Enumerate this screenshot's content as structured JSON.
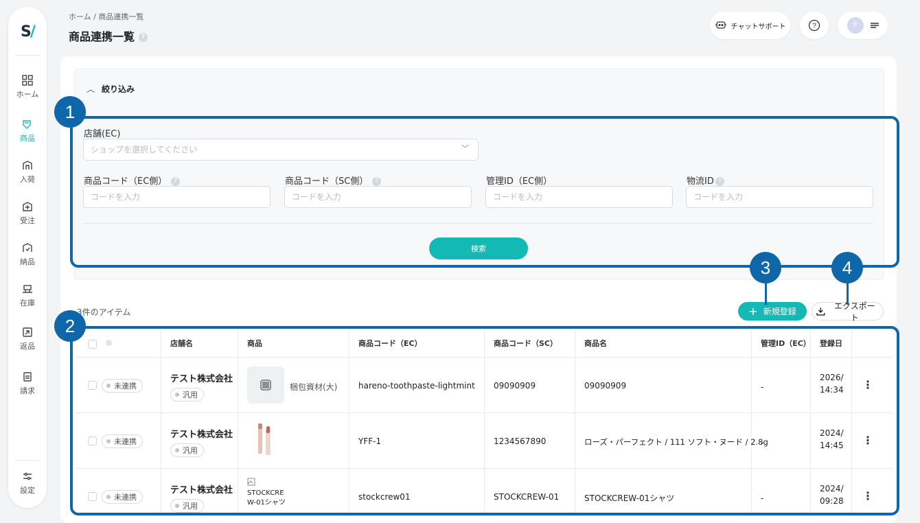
{
  "brand": {
    "logo": "S/",
    "accent": "#14b8b4",
    "annotation_color": "#0f67a9"
  },
  "sidebar": {
    "items": [
      {
        "label": "ホーム",
        "icon": "grid-icon",
        "active": false
      },
      {
        "label": "商品",
        "icon": "tag-icon",
        "active": true
      },
      {
        "label": "入荷",
        "icon": "inbound-icon",
        "active": false
      },
      {
        "label": "受注",
        "icon": "order-icon",
        "active": false
      },
      {
        "label": "納品",
        "icon": "delivery-icon",
        "active": false
      },
      {
        "label": "在庫",
        "icon": "stock-icon",
        "active": false
      },
      {
        "label": "返品",
        "icon": "return-icon",
        "active": false
      },
      {
        "label": "請求",
        "icon": "invoice-icon",
        "active": false
      }
    ],
    "settings": {
      "label": "設定",
      "icon": "sliders-icon"
    }
  },
  "header": {
    "breadcrumb": "ホーム / 商品連携一覧",
    "title": "商品連携一覧",
    "chat_support": "チャットサポート",
    "help": "?",
    "avatar_initial": "テ"
  },
  "filter": {
    "toggle_label": "絞り込み",
    "store_label": "店舗(EC)",
    "store_placeholder": "ショップを選択してください",
    "code_ec_label": "商品コード（EC側）",
    "code_sc_label": "商品コード（SC側）",
    "manage_id_label": "管理ID（EC側）",
    "logistics_id_label": "物流ID",
    "code_placeholder": "コードを入力",
    "search_button": "検索"
  },
  "list": {
    "count_text": "3件のアイテム",
    "new_button": "新規登録",
    "export_button": "エクスポート",
    "headers": [
      "店舗名",
      "商品",
      "商品コード（EC）",
      "商品コード（SC）",
      "商品名",
      "管理ID（EC）",
      "登録日"
    ],
    "rows": [
      {
        "status": "未連携",
        "shop": "テスト株式会社",
        "shop_tag": "汎用",
        "product_label": "梱包資材(大)",
        "image_alt": "",
        "code_ec": "hareno-toothpaste-lightmint",
        "code_sc": "09090909",
        "name": "09090909",
        "manage_id": "-",
        "date": "2026/",
        "time": "14:34"
      },
      {
        "status": "未連携",
        "shop": "テスト株式会社",
        "shop_tag": "汎用",
        "product_label": "",
        "image_alt": "",
        "code_ec": "YFF-1",
        "code_sc": "1234567890",
        "name": "ローズ・パーフェクト / 111 ソフト・ヌード / 2.8g",
        "manage_id": "-",
        "date": "2024/",
        "time": "14:45"
      },
      {
        "status": "未連携",
        "shop": "テスト株式会社",
        "shop_tag": "汎用",
        "product_label": "",
        "image_alt": "STOCKCREW-01シャツ",
        "code_ec": "stockcrew01",
        "code_sc": "STOCKCREW-01",
        "name": "STOCKCREW-01シャツ",
        "manage_id": "-",
        "date": "2024/",
        "time": "09:28"
      }
    ]
  },
  "annotations": [
    {
      "number": "1",
      "target": "filter-fields"
    },
    {
      "number": "2",
      "target": "product-table"
    },
    {
      "number": "3",
      "target": "new-registration-button"
    },
    {
      "number": "4",
      "target": "export-button"
    }
  ]
}
